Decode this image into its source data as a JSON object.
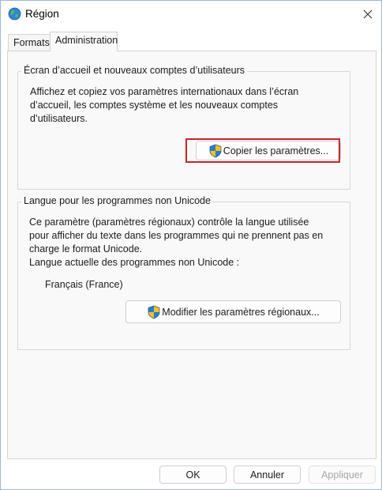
{
  "window": {
    "title": "Région",
    "icon": "globe-icon",
    "close_icon": "close-icon"
  },
  "tabs": [
    {
      "label": "Formats",
      "active": false
    },
    {
      "label": "Administration",
      "active": true
    }
  ],
  "welcome_group": {
    "legend": "Écran d’accueil et nouveaux comptes d’utilisateurs",
    "description_lines": [
      "Affichez et copiez vos paramètres internationaux dans l’écran",
      "d’accueil, les comptes système et les nouveaux comptes",
      "d’utilisateurs."
    ],
    "copy_button_label": "Copier les paramètres...",
    "copy_button_icon": "uac-shield-icon"
  },
  "unicode_group": {
    "legend": "Langue pour les programmes non Unicode",
    "description_lines": [
      "Ce paramètre (paramètres régionaux) contrôle la langue utilisée",
      "pour afficher du texte dans les programmes qui ne prennent pas en",
      "charge le format Unicode."
    ],
    "current_label": "Langue actuelle des programmes non Unicode :",
    "current_value": "Français (France)",
    "change_button_label": "Modifier les paramètres régionaux...",
    "change_button_icon": "uac-shield-icon"
  },
  "footer": {
    "ok_label": "OK",
    "cancel_label": "Annuler",
    "apply_label": "Appliquer"
  },
  "colors": {
    "highlight_border": "#c4262e",
    "panel_background": "#f9f9f9"
  }
}
